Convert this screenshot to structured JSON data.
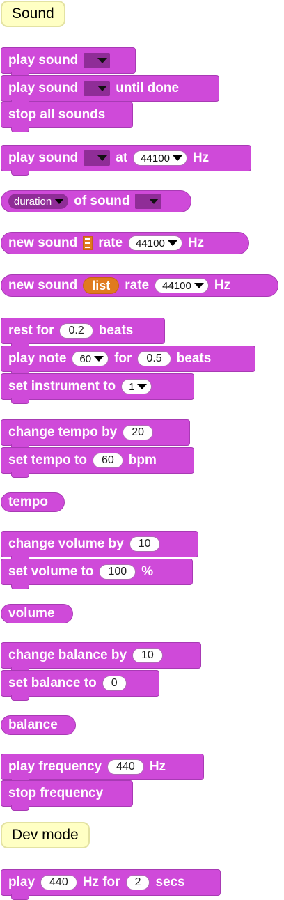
{
  "category": {
    "sound": "Sound",
    "dev_mode": "Dev mode"
  },
  "blocks": {
    "play_sound": "play sound",
    "play_sound_until_a": "play sound",
    "play_sound_until_b": "until done",
    "stop_all_sounds": "stop all sounds",
    "play_sound_at_a": "play sound",
    "play_sound_at_b": "at",
    "play_sound_at_rate": "44100",
    "play_sound_at_c": "Hz",
    "duration_label": "duration",
    "of_sound": "of sound",
    "new_sound_a": "new sound",
    "new_sound_rate": "rate",
    "new_sound_value": "44100",
    "new_sound_hz": "Hz",
    "new_sound_list_a": "new sound",
    "new_sound_list_arg": "list",
    "new_sound_list_rate": "rate",
    "new_sound_list_value": "44100",
    "new_sound_list_hz": "Hz",
    "rest_for": "rest for",
    "rest_val": "0.2",
    "rest_beats": "beats",
    "play_note": "play note",
    "play_note_val": "60",
    "play_note_for": "for",
    "play_note_dur": "0.5",
    "play_note_beats": "beats",
    "set_instrument": "set instrument to",
    "set_instrument_val": "1",
    "change_tempo": "change tempo by",
    "change_tempo_val": "20",
    "set_tempo": "set tempo to",
    "set_tempo_val": "60",
    "set_tempo_unit": "bpm",
    "tempo": "tempo",
    "change_volume": "change volume by",
    "change_volume_val": "10",
    "set_volume": "set volume to",
    "set_volume_val": "100",
    "set_volume_unit": "%",
    "volume": "volume",
    "change_balance": "change balance by",
    "change_balance_val": "10",
    "set_balance": "set balance to",
    "set_balance_val": "0",
    "balance": "balance",
    "play_frequency": "play frequency",
    "play_frequency_val": "440",
    "play_frequency_unit": "Hz",
    "stop_frequency": "stop frequency",
    "play_a": "play",
    "play_freq": "440",
    "play_hz_for": "Hz for",
    "play_secs_val": "2",
    "play_secs": "secs"
  },
  "colors": {
    "block": "#cf4ad9",
    "dropdown_dark": "#8f2d97",
    "list": "#e07a1f",
    "category": "#ffffc4"
  }
}
